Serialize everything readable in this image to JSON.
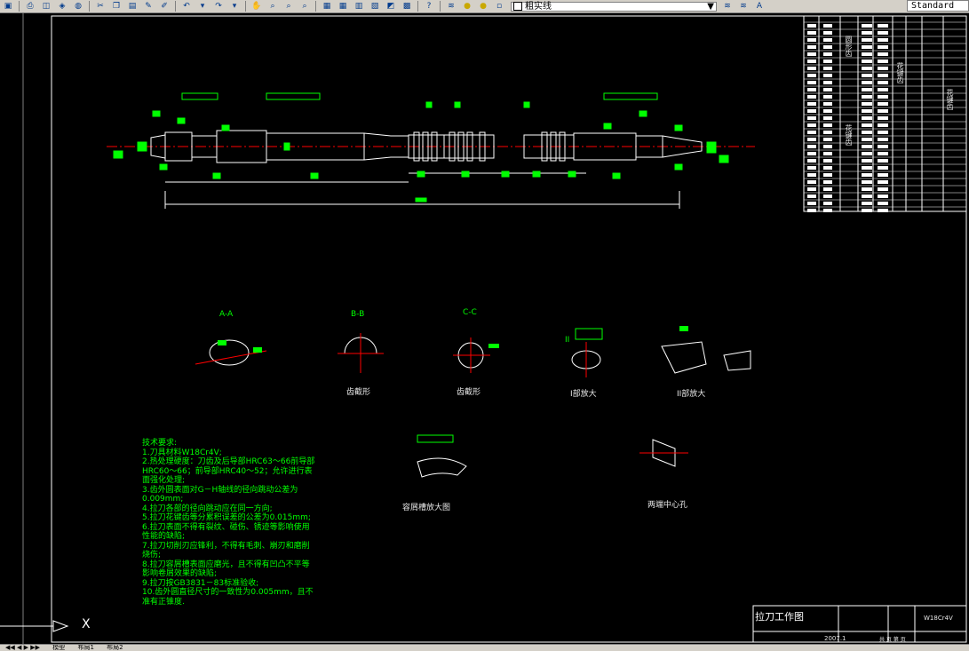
{
  "toolbar": {
    "layer_current": "粗实线",
    "style_current": "Standard",
    "icons": [
      "save-icon",
      "print-icon",
      "preview-icon",
      "publish-icon",
      "cut-icon",
      "copy-icon",
      "paste-icon",
      "matchprop-icon",
      "undo-icon",
      "redo-icon",
      "pan-icon",
      "zoom-icon",
      "zoom-window-icon",
      "zoom-prev-icon",
      "properties-icon",
      "design-center-icon",
      "tool-palette-icon",
      "sheetset-icon",
      "markup-icon",
      "calc-icon",
      "help-icon",
      "layer-icon",
      "lightbulb-icon"
    ]
  },
  "drawing": {
    "section_labels": {
      "aa": "A-A",
      "bb": "B-B",
      "cc": "C-C",
      "roman2": "II"
    },
    "captions": {
      "bb": "齿截形",
      "cc": "齿截形",
      "detail1": "I部放大",
      "detail2": "II部放大",
      "chipspace": "容屑槽放大图",
      "centerhole": "两端中心孔"
    },
    "vertical_labels": [
      "圆形齿",
      "花键齿",
      "花键齿",
      "花键齿"
    ]
  },
  "notes": {
    "title": "技术要求:",
    "lines": [
      "1.刀具材料W18Cr4V;",
      "2.热处理硬度：刀齿及后导部HRC63～66前导部HRC60～66；前导部HRC40～52；允许进行表面强化处理;",
      "3.齿外圆表面对G－H轴线的径向跳动公差为0.009mm;",
      "4.拉刀各部的径向跳动应在同一方向;",
      "5.拉刀花键齿等分累积误差的公差为0.015mm;",
      "6.拉刀表面不得有裂纹、碰伤、锈迹等影响使用性能的缺陷;",
      "7.拉刀切削刃应锋利，不得有毛刺、崩刃和磨削烧伤;",
      "8.拉刀容屑槽表面应磨光，且不得有凹凸不平等影响卷屑效果的缺陷;",
      "9.拉刀按GB3831－83标准验收;",
      "10.齿外圆直径尺寸的一致性为0.005mm，且不准有正锥度."
    ]
  },
  "title_block": {
    "title": "拉刀工作图",
    "material": "W18Cr4V",
    "year": "2007.1",
    "sheets": "共 页 第 页"
  },
  "axis_label": "X",
  "tabs": [
    "模型",
    "布局1",
    "布局2"
  ],
  "colors": {
    "bg": "#000000",
    "cad_green": "#00ff00",
    "cad_red": "#ff0000",
    "cad_white": "#ffffff",
    "ui_gray": "#d4d0c8"
  }
}
